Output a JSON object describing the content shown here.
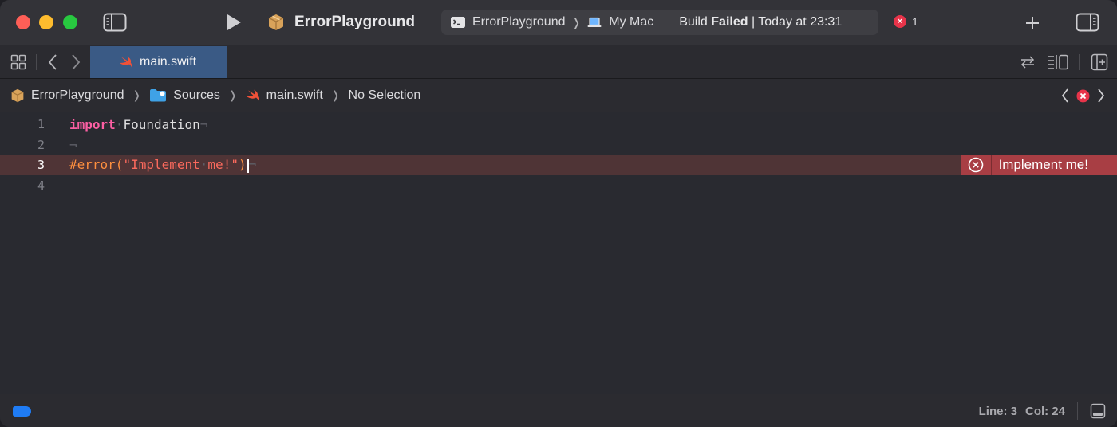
{
  "toolbar": {
    "app_title": "ErrorPlayground",
    "scheme": "ErrorPlayground",
    "destination": "My Mac",
    "build_prefix": "Build ",
    "build_state": "Failed",
    "build_time": " | Today at 23:31",
    "error_count": "1",
    "error_dot_glyph": "×"
  },
  "tabbar": {
    "active_tab": "main.swift"
  },
  "jumpbar": {
    "crumbs": [
      "ErrorPlayground",
      "Sources",
      "main.swift",
      "No Selection"
    ]
  },
  "editor": {
    "line_numbers": [
      "1",
      "2",
      "3",
      "4"
    ],
    "line1_keyword": "import",
    "line1_space": "·",
    "line1_module": "Foundation",
    "eol": "¬",
    "line3_directive": "#error(",
    "line3_quote": "\"",
    "line3_str_a": "Implement",
    "line3_space": "·",
    "line3_str_b": "me!\"",
    "line3_close": ")",
    "error_message": "Implement me!"
  },
  "statusbar": {
    "line_label": "Line: 3",
    "col_label": "Col: 24"
  },
  "colors": {
    "accent": "#1f7cf5",
    "error": "#e8344a",
    "tab_active": "#3a5a85",
    "error_line": "#4f3436"
  }
}
